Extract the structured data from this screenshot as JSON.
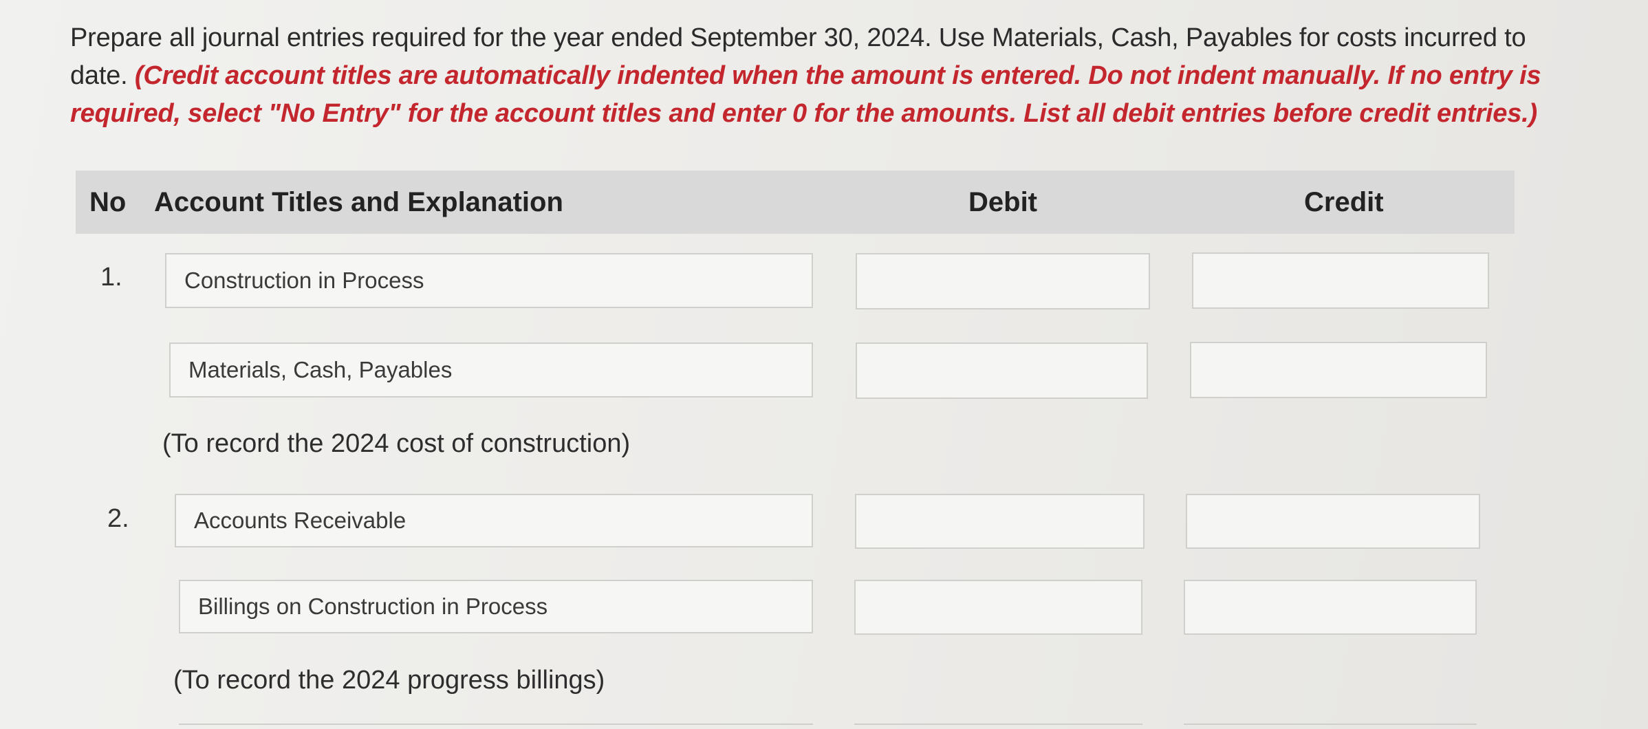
{
  "instructions": {
    "plain_text": "Prepare all journal entries required for the year ended September 30, 2024. Use Materials, Cash, Payables for costs incurred to date. ",
    "red_text": "(Credit account titles are automatically indented when the amount is entered. Do not indent manually. If no entry is required, select \"No Entry\" for the account titles and enter 0 for the amounts. List all debit entries before credit entries.)"
  },
  "table": {
    "headers": {
      "no": "No",
      "account": "Account Titles and Explanation",
      "debit": "Debit",
      "credit": "Credit"
    }
  },
  "entries": [
    {
      "no": "1.",
      "lines": [
        {
          "account": "Construction in Process",
          "debit": "",
          "credit": ""
        },
        {
          "account": "Materials, Cash, Payables",
          "debit": "",
          "credit": ""
        }
      ],
      "memo": "(To record the 2024 cost of construction)"
    },
    {
      "no": "2.",
      "lines": [
        {
          "account": "Accounts Receivable",
          "debit": "",
          "credit": ""
        },
        {
          "account": "Billings on Construction in Process",
          "debit": "",
          "credit": ""
        }
      ],
      "memo": "(To record the 2024 progress billings)"
    }
  ]
}
